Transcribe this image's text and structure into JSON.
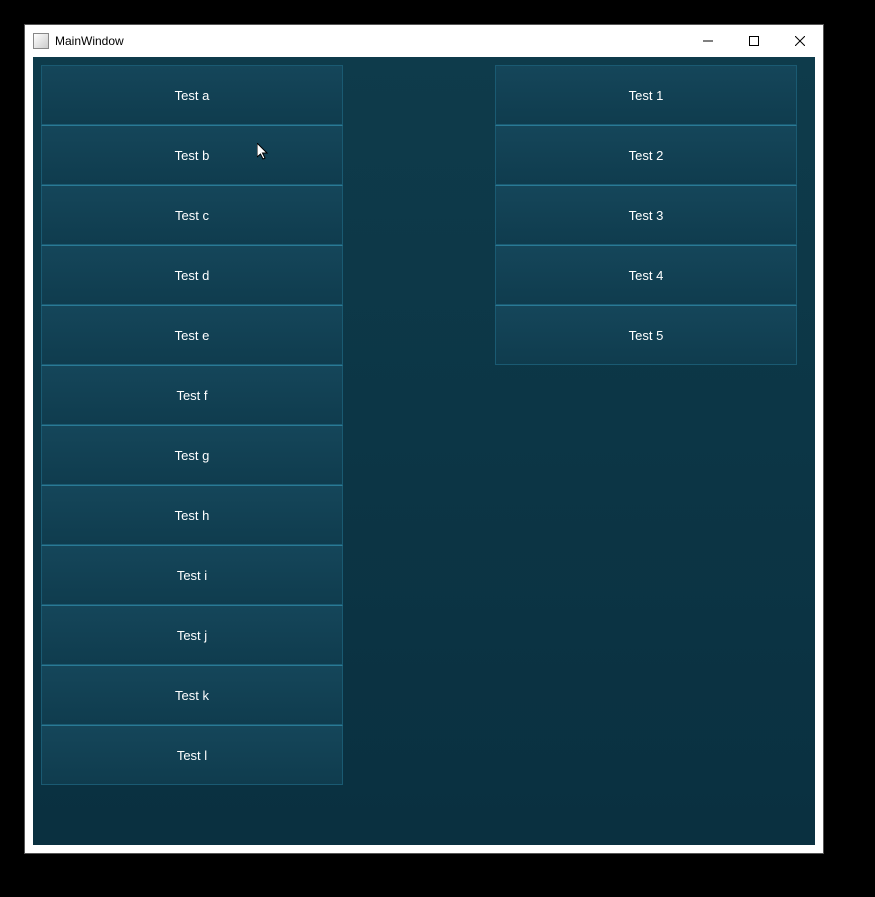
{
  "window": {
    "title": "MainWindow"
  },
  "leftList": {
    "items": [
      {
        "label": "Test a"
      },
      {
        "label": "Test b"
      },
      {
        "label": "Test c"
      },
      {
        "label": "Test d"
      },
      {
        "label": "Test e"
      },
      {
        "label": "Test f"
      },
      {
        "label": "Test g"
      },
      {
        "label": "Test h"
      },
      {
        "label": "Test i"
      },
      {
        "label": "Test j"
      },
      {
        "label": "Test k"
      },
      {
        "label": "Test l"
      }
    ]
  },
  "rightList": {
    "items": [
      {
        "label": "Test 1"
      },
      {
        "label": "Test 2"
      },
      {
        "label": "Test 3"
      },
      {
        "label": "Test 4"
      },
      {
        "label": "Test 5"
      }
    ]
  },
  "colors": {
    "clientBg": "#0d3a4a",
    "itemBg": "#15465a",
    "itemBorder": "#1a5a72",
    "textColor": "#ffffff"
  }
}
